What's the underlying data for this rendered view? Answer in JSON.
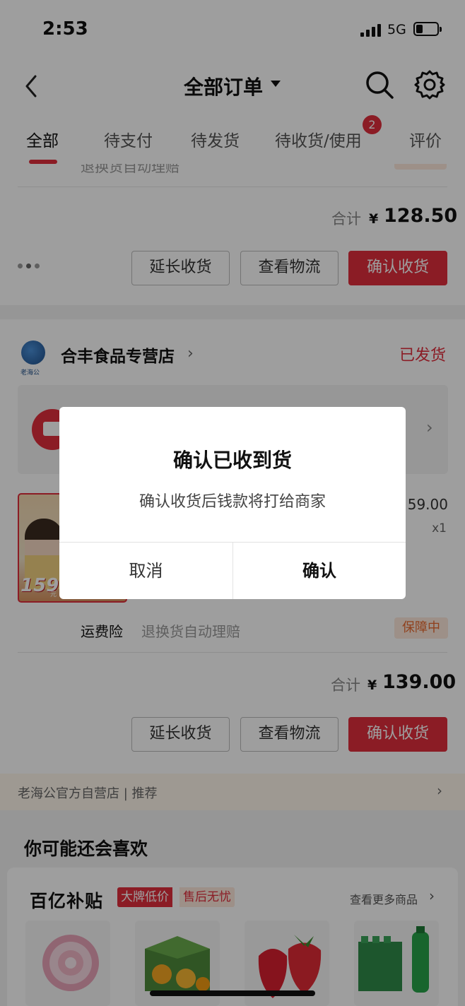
{
  "status_bar": {
    "time": "2:53",
    "network": "5G",
    "battery_level": 0.25
  },
  "nav": {
    "title": "全部订单"
  },
  "tabs": [
    {
      "label": "全部",
      "active": true
    },
    {
      "label": "待支付"
    },
    {
      "label": "待发货"
    },
    {
      "label": "待收货/使用",
      "badge": "2"
    },
    {
      "label": "评价"
    }
  ],
  "order1": {
    "clipped_text": "退换货自动理赔",
    "total_label": "合计",
    "currency": "¥",
    "total_amount": "128.50",
    "buttons": {
      "extend": "延长收货",
      "logistics": "查看物流",
      "confirm": "确认收货"
    }
  },
  "order2": {
    "store_logo_text": "老海公",
    "store_name": "合丰食品专营店",
    "status": "已发货",
    "product": {
      "thumb_price": "159",
      "thumb_unit": "元",
      "price": "59.00",
      "qty": "x1"
    },
    "insurance": {
      "label": "运费险",
      "desc": "退换货自动理赔",
      "tag": "保障中"
    },
    "total_label": "合计",
    "currency": "¥",
    "total_amount": "139.00",
    "buttons": {
      "extend": "延长收货",
      "logistics": "查看物流",
      "confirm": "确认收货"
    }
  },
  "recommend_bar": {
    "text": "老海公官方自营店 | 推荐"
  },
  "you_may_like": {
    "title": "你可能还会喜欢"
  },
  "subsidy": {
    "logo": "百亿补贴",
    "tag1": "大牌低价",
    "tag2": "售后无忧",
    "more": "查看更多商品"
  },
  "dialog": {
    "title": "确认已收到货",
    "message": "确认收货后钱款将打给商家",
    "cancel": "取消",
    "confirm": "确认"
  },
  "colors": {
    "accent": "#e02e3c",
    "tag_bg": "#fde8dc"
  }
}
